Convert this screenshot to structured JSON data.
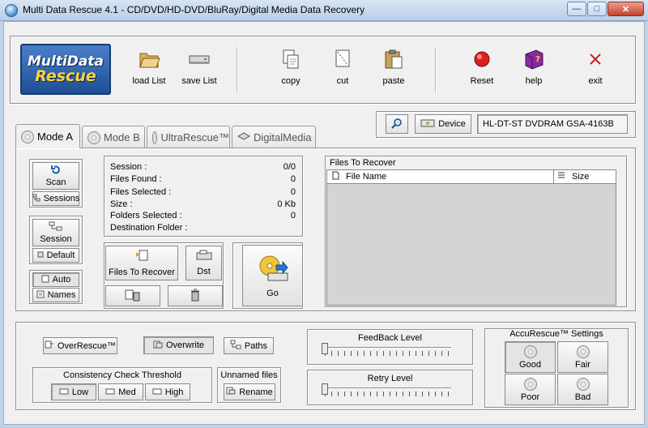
{
  "window": {
    "title": "Multi Data Rescue 4.1  -  CD/DVD/HD-DVD/BluRay/Digital Media  Data Recovery",
    "controls": {
      "minimize": "—",
      "maximize": "□",
      "close": "✕"
    }
  },
  "logo": {
    "line1": "MultiData",
    "line2": "Rescue"
  },
  "toolbar": {
    "load_list": "load List",
    "save_list": "save List",
    "copy": "copy",
    "cut": "cut",
    "paste": "paste",
    "reset": "Reset",
    "help": "help",
    "exit": "exit"
  },
  "device_bar": {
    "device_label": "Device",
    "device_name": "HL-DT-ST DVDRAM GSA-4163B"
  },
  "tabs": {
    "mode_a": "Mode A",
    "mode_b": "Mode B",
    "ultra_rescue": "UltraRescue™",
    "digital_media": "DigitalMedia"
  },
  "left_buttons": {
    "scan": "Scan",
    "sessions": "Sessions",
    "session": "Session",
    "default": "Default",
    "auto": "Auto",
    "names": "Names"
  },
  "stats": {
    "session_label": "Session :",
    "session_value": "0/0",
    "files_found_label": "Files Found :",
    "files_found_value": "0",
    "files_selected_label": "Files Selected :",
    "files_selected_value": "0",
    "size_label": "Size :",
    "size_value": "0 Kb",
    "folders_selected_label": "Folders Selected :",
    "folders_selected_value": "0",
    "destination_folder_label": "Destination Folder :"
  },
  "actions": {
    "files_to_recover": "Files To Recover",
    "dst": "Dst",
    "go": "Go"
  },
  "recover_panel": {
    "title": "Files To Recover",
    "columns": {
      "file_name": "File Name",
      "size": "Size"
    }
  },
  "options": {
    "over_rescue": "OverRescue™",
    "overwrite": "Overwrite",
    "paths": "Paths",
    "consistency_title": "Consistency Check Threshold",
    "low": "Low",
    "med": "Med",
    "high": "High",
    "unnamed_title": "Unnamed files",
    "rename": "Rename"
  },
  "sliders": {
    "feedback_label": "FeedBack Level",
    "feedback_level": 0,
    "retry_label": "Retry Level",
    "retry_level": 0
  },
  "accurescue": {
    "title": "AccuRescue™ Settings",
    "good": "Good",
    "fair": "Fair",
    "poor": "Poor",
    "bad": "Bad",
    "selected": "Good"
  }
}
